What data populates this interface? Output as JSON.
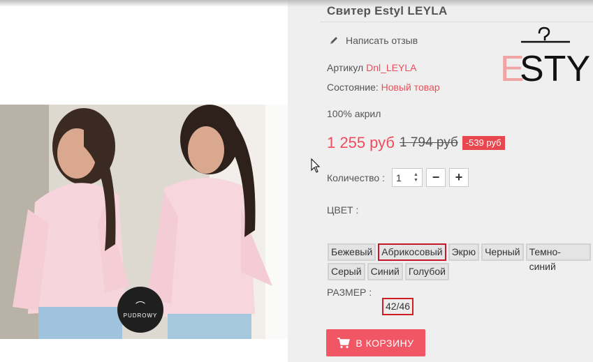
{
  "product": {
    "title": "Свитер Estyl LEYLA",
    "review_link": "Написать отзыв",
    "article_label": "Артикул",
    "article_value": "Dnl_LEYLA",
    "condition_label": "Состояние:",
    "condition_value": "Новый товар",
    "composition": "100% акрил"
  },
  "price": {
    "current": "1 255 руб",
    "old": "1 794 руб",
    "discount": "-539 руб"
  },
  "quantity": {
    "label": "Количество :",
    "value": "1",
    "minus": "−",
    "plus": "+"
  },
  "color": {
    "label": "ЦВЕТ :",
    "selected": "Абрикосовый",
    "options_row1": [
      "Бежевый",
      "Абрикосовый",
      "Экрю",
      "Черный",
      "Темно-синий"
    ],
    "options_row2": [
      "Серый",
      "Синий",
      "Голубой"
    ]
  },
  "size": {
    "label": "РАЗМЕР :",
    "selected": "42/46"
  },
  "cart_button": "В КОРЗИНУ",
  "brand": {
    "logo_text_e": "E",
    "logo_text": "STYL",
    "badge_text": "PUDROWY"
  },
  "colors": {
    "accent": "#f15664",
    "price": "#ef4b5d",
    "link": "#e8505b",
    "panel_bg": "#efefef"
  },
  "icons": [
    "pencil-icon",
    "spinner-icon",
    "minus-icon",
    "plus-icon",
    "cart-icon",
    "hanger-icon",
    "mouse-cursor-icon"
  ]
}
